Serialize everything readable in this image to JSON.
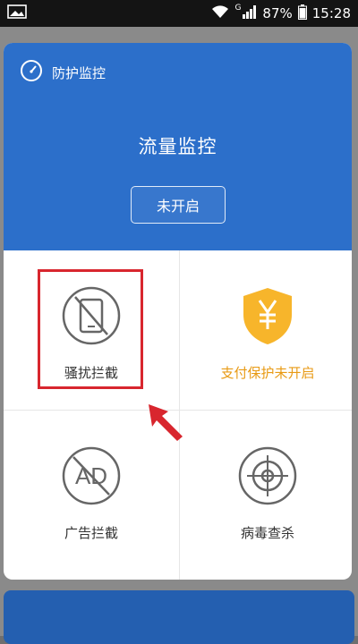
{
  "status_bar": {
    "network_sup": "G",
    "battery": "87%",
    "time": "15:28"
  },
  "header": {
    "title": "防护监控",
    "main_label": "流量监控",
    "status_button": "未开启"
  },
  "grid": [
    {
      "label": "骚扰拦截",
      "icon": "phone-blocked-icon"
    },
    {
      "label": "支付保护未开启",
      "icon": "payment-shield-icon"
    },
    {
      "label": "广告拦截",
      "icon": "ad-block-icon"
    },
    {
      "label": "病毒查杀",
      "icon": "virus-target-icon"
    }
  ],
  "colors": {
    "header_blue": "#2c6fca",
    "highlight_red": "#d8262e",
    "warn_orange": "#e89a14"
  }
}
